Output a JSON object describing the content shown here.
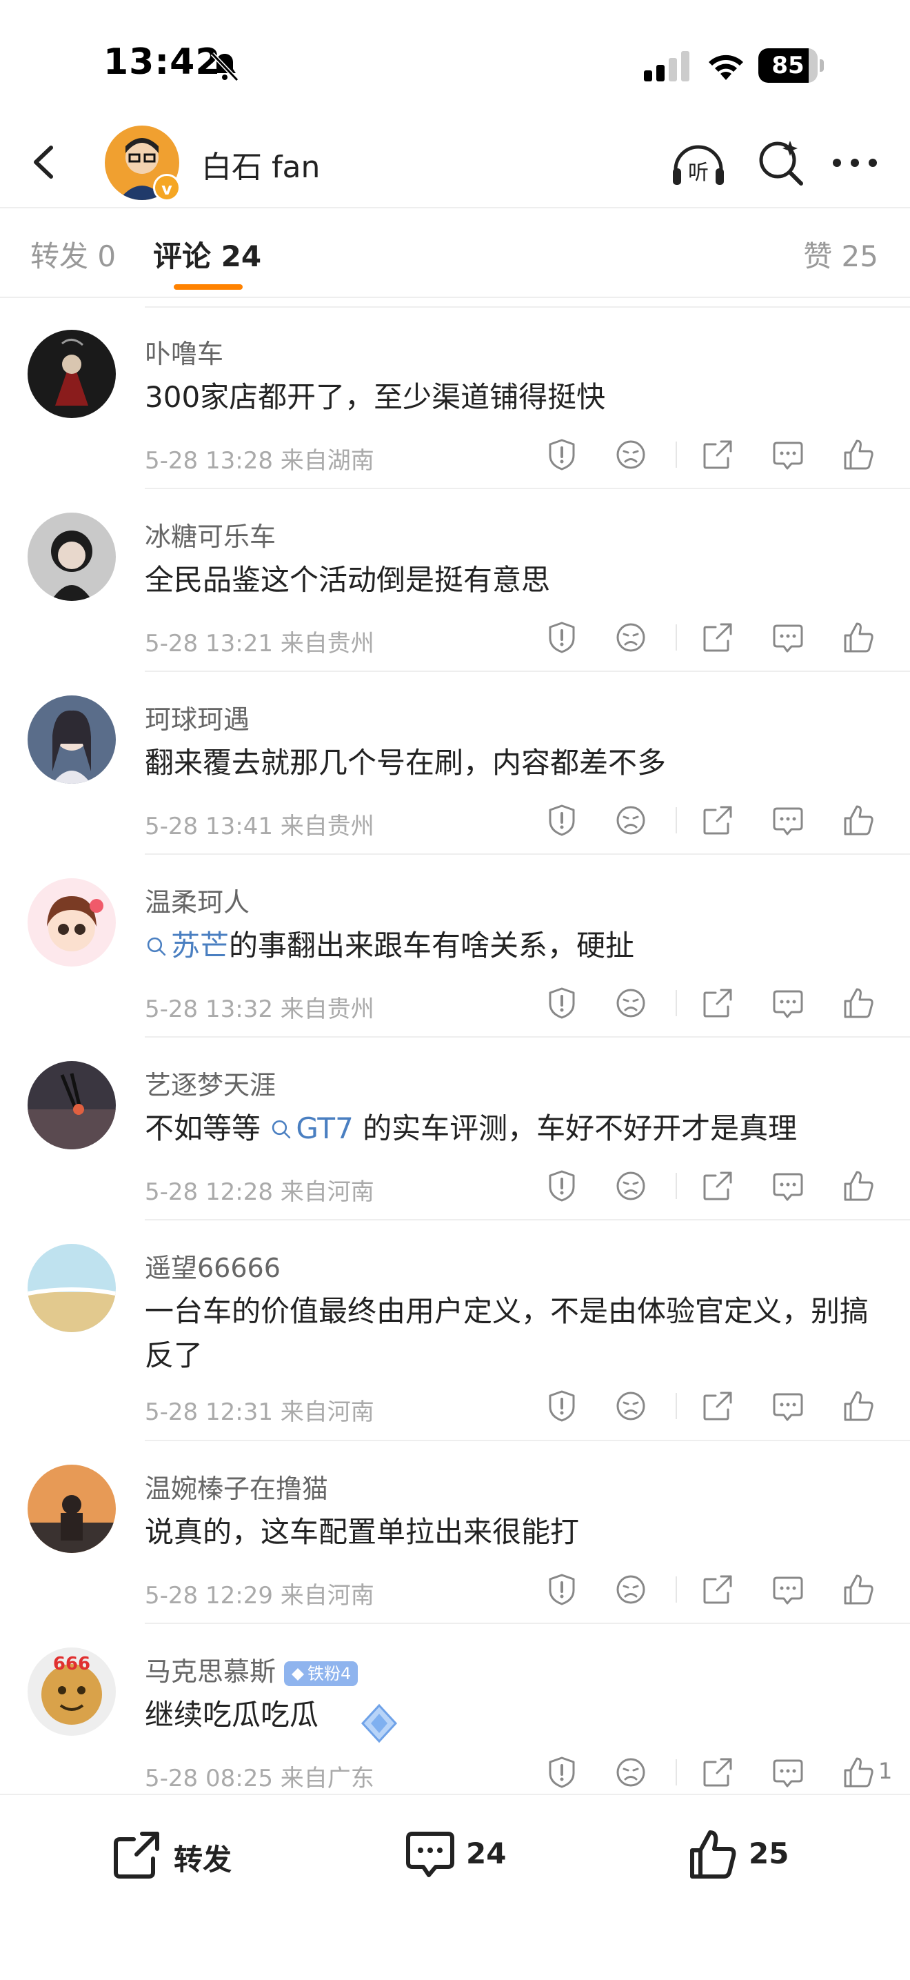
{
  "status_bar": {
    "time": "13:42",
    "battery": "85",
    "battery_level": 0.85
  },
  "header": {
    "title": "白石 fan",
    "verified_mark": "v"
  },
  "tabs": {
    "repost": "转发 0",
    "comment": "评论 24",
    "like": "赞 25"
  },
  "comments": [
    {
      "name": "卟噜车",
      "text": [
        {
          "t": "300家店都开了，至少渠道铺得挺快"
        }
      ],
      "meta": "5-28 13:28  来自湖南"
    },
    {
      "name": "冰糖可乐车",
      "text": [
        {
          "t": "全民品鉴这个活动倒是挺有意思"
        }
      ],
      "meta": "5-28 13:21  来自贵州"
    },
    {
      "name": "珂球珂遇",
      "text": [
        {
          "t": "翻来覆去就那几个号在刷，内容都差不多"
        }
      ],
      "meta": "5-28 13:41  来自贵州"
    },
    {
      "name": "温柔珂人",
      "text": [
        {
          "t": "苏芒",
          "link": true
        },
        {
          "t": "的事翻出来跟车有啥关系，硬扯"
        }
      ],
      "meta": "5-28 13:32  来自贵州"
    },
    {
      "name": "艺逐梦天涯",
      "text": [
        {
          "t": "不如等等 "
        },
        {
          "t": "GT7",
          "link": true
        },
        {
          "t": " 的实车评测，车好不好开才是真理"
        }
      ],
      "meta": "5-28 12:28  来自河南"
    },
    {
      "name": "遥望66666",
      "text": [
        {
          "t": "一台车的价值最终由用户定义，不是由体验官定义，别搞反了"
        }
      ],
      "meta": "5-28 12:31  来自河南"
    },
    {
      "name": "温婉榛子在撸猫",
      "text": [
        {
          "t": "说真的，这车配置单拉出来很能打"
        }
      ],
      "meta": "5-28 12:29  来自河南"
    },
    {
      "name": "马克思慕斯",
      "badge": "铁粉4",
      "text": [
        {
          "t": "继续吃瓜吃瓜"
        }
      ],
      "meta": "5-28 08:25  来自广东",
      "like_count": "1"
    }
  ],
  "bottom_bar": {
    "repost": "转发",
    "comment": "24",
    "like": "25"
  },
  "colors": {
    "accent": "#ff8200",
    "link": "#4a7fc1",
    "fan_badge": "#8fb4ee",
    "verified": "#f5a623"
  },
  "icons": [
    "bell-slash-icon",
    "signal-icon",
    "wifi-icon",
    "battery-icon",
    "back-icon",
    "listen-icon",
    "search-icon",
    "more-icon",
    "report-icon",
    "dislike-icon",
    "share-icon",
    "reply-icon",
    "like-icon",
    "search-link-icon",
    "diamond-icon"
  ]
}
